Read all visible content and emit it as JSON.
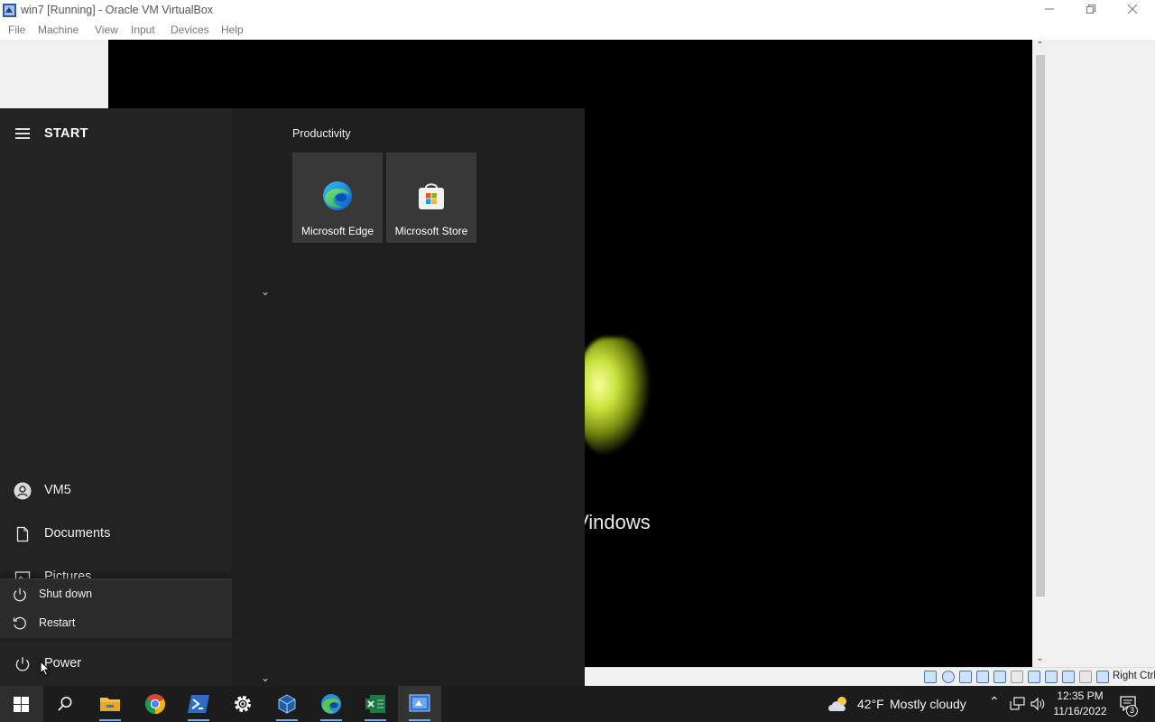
{
  "host_window": {
    "title": "win7 [Running] - Oracle VM VirtualBox",
    "icon": "virtualbox-icon",
    "controls": [
      "minimize-icon",
      "restore-icon",
      "close-icon"
    ],
    "menu": [
      "File",
      "Machine",
      "View",
      "Input",
      "Devices",
      "Help"
    ]
  },
  "vm_screen": {
    "boot_text": "Vindows"
  },
  "vbox_status": {
    "host_key_label": "Right Ctrl",
    "icons": [
      "hard-disk-icon",
      "optical-drive-icon",
      "audio-icon",
      "network-icon",
      "usb-icon",
      "shared-folder-icon",
      "display-icon",
      "recording-icon",
      "cpu-icon",
      "mouse-integration-icon",
      "keyboard-icon"
    ]
  },
  "start_menu": {
    "heading": "START",
    "left_items": [
      {
        "label": "VM5",
        "icon": "user-avatar-icon"
      },
      {
        "label": "Documents",
        "icon": "document-icon"
      },
      {
        "label": "Pictures",
        "icon": "picture-icon"
      },
      {
        "label": "Power",
        "icon": "power-icon"
      }
    ],
    "power_flyout": [
      {
        "label": "Shut down",
        "icon": "power-icon"
      },
      {
        "label": "Restart",
        "icon": "restart-icon"
      }
    ],
    "group_title": "Productivity",
    "tiles": [
      {
        "label": "Microsoft Edge",
        "icon": "edge-icon"
      },
      {
        "label": "Microsoft Store",
        "icon": "store-icon"
      }
    ]
  },
  "taskbar": {
    "pinned": [
      "start-icon",
      "search-icon",
      "file-explorer-icon",
      "chrome-icon",
      "powershell-icon",
      "settings-icon",
      "virtualbox-icon",
      "edge-icon",
      "excel-icon",
      "virtual-machine-icon"
    ],
    "weather": {
      "temp": "42°F",
      "condition": "Mostly cloudy"
    },
    "time": "12:35 PM",
    "date": "11/16/2022",
    "notifications": "3"
  }
}
